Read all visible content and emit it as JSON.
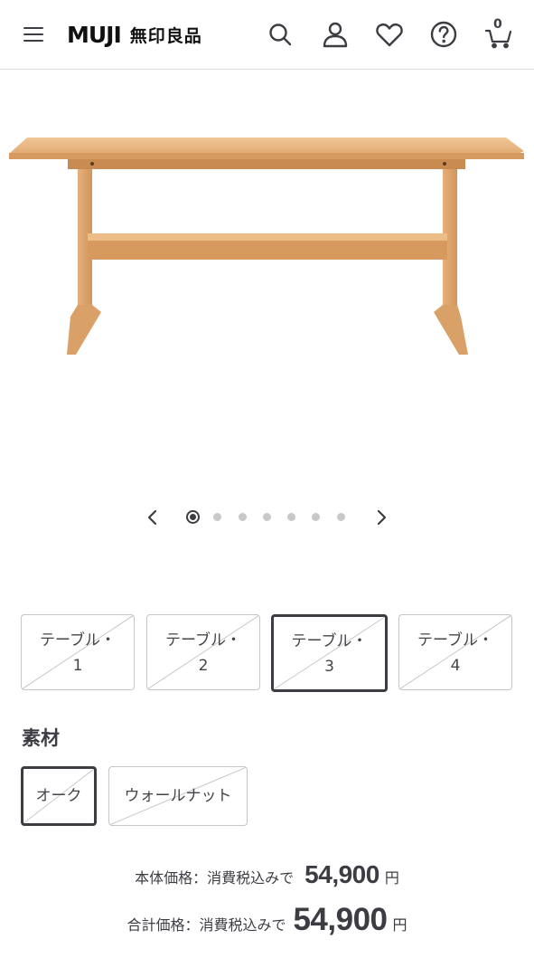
{
  "header": {
    "logo_text": "MUJI",
    "logo_kanji": "無印良品",
    "cart_count": "0",
    "icons": [
      "menu-icon",
      "search-icon",
      "account-icon",
      "heart-icon",
      "help-icon",
      "cart-icon"
    ]
  },
  "product": {
    "image_icon": "wooden-dining-table",
    "carousel": {
      "total_slides": 7,
      "active_index": 0
    }
  },
  "sizes": {
    "options": [
      {
        "line1": "テーブル・",
        "line2": "1"
      },
      {
        "line1": "テーブル・",
        "line2": "2"
      },
      {
        "line1": "テーブル・",
        "line2": "3"
      },
      {
        "line1": "テーブル・",
        "line2": "4"
      }
    ],
    "selected_index": 2
  },
  "material": {
    "title": "素材",
    "options": [
      "オーク",
      "ウォールナット"
    ],
    "selected_index": 0
  },
  "price": {
    "base_label": "本体価格：消費税込みで",
    "base_amount": "54,900",
    "total_label": "合計価格：消費税込みで",
    "total_amount": "54,900",
    "currency": "円"
  },
  "colors": {
    "text": "#3c3c43",
    "wood": "#e0a868",
    "dot_inactive": "#c8c8c8"
  }
}
